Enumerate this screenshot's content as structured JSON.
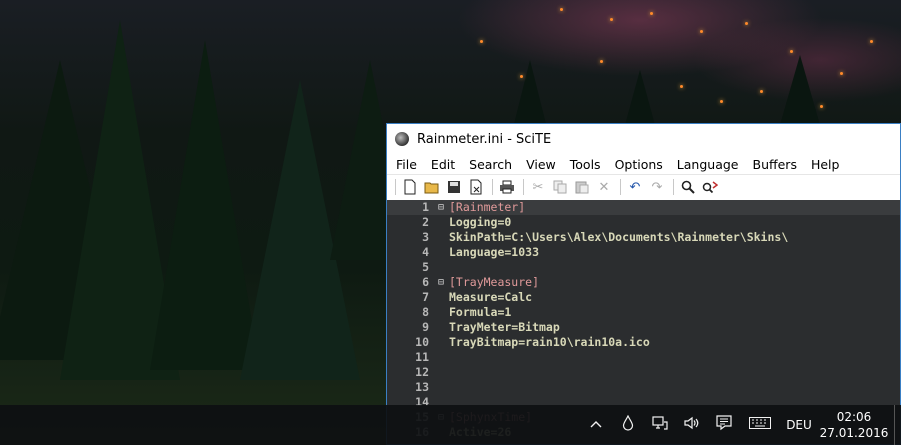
{
  "window": {
    "title": "Rainmeter.ini - SciTE",
    "menu": [
      "File",
      "Edit",
      "Search",
      "View",
      "Tools",
      "Options",
      "Language",
      "Buffers",
      "Help"
    ],
    "toolbar_icons": [
      "new-file-icon",
      "open-folder-icon",
      "save-icon",
      "close-file-icon",
      "print-icon",
      "cut-icon",
      "copy-icon",
      "paste-icon",
      "delete-icon",
      "undo-icon",
      "redo-icon",
      "find-icon",
      "replace-icon"
    ]
  },
  "editor": {
    "lines": [
      {
        "num": "1",
        "text": "[Rainmeter]",
        "fold": "⊟",
        "section": true,
        "current": true
      },
      {
        "num": "2",
        "text": "Logging=0"
      },
      {
        "num": "3",
        "text": "SkinPath=C:\\Users\\Alex\\Documents\\Rainmeter\\Skins\\"
      },
      {
        "num": "4",
        "text": "Language=1033"
      },
      {
        "num": "5",
        "text": ""
      },
      {
        "num": "6",
        "text": "[TrayMeasure]",
        "fold": "⊟",
        "section": true
      },
      {
        "num": "7",
        "text": "Measure=Calc"
      },
      {
        "num": "8",
        "text": "Formula=1"
      },
      {
        "num": "9",
        "text": "TrayMeter=Bitmap"
      },
      {
        "num": "10",
        "text": "TrayBitmap=rain10\\rain10a.ico"
      },
      {
        "num": "11",
        "text": ""
      },
      {
        "num": "12",
        "text": ""
      },
      {
        "num": "13",
        "text": ""
      },
      {
        "num": "14",
        "text": ""
      },
      {
        "num": "15",
        "text": "[SphynxTime]",
        "fold": "⊟",
        "section": true
      },
      {
        "num": "16",
        "text": "Active=26"
      }
    ]
  },
  "taskbar": {
    "tray_icons": [
      "chevron-up-icon",
      "droplet-icon",
      "network-icon",
      "volume-icon",
      "notification-icon",
      "keyboard-icon"
    ],
    "language": "DEU",
    "time": "02:06",
    "date": "27.01.2016"
  }
}
